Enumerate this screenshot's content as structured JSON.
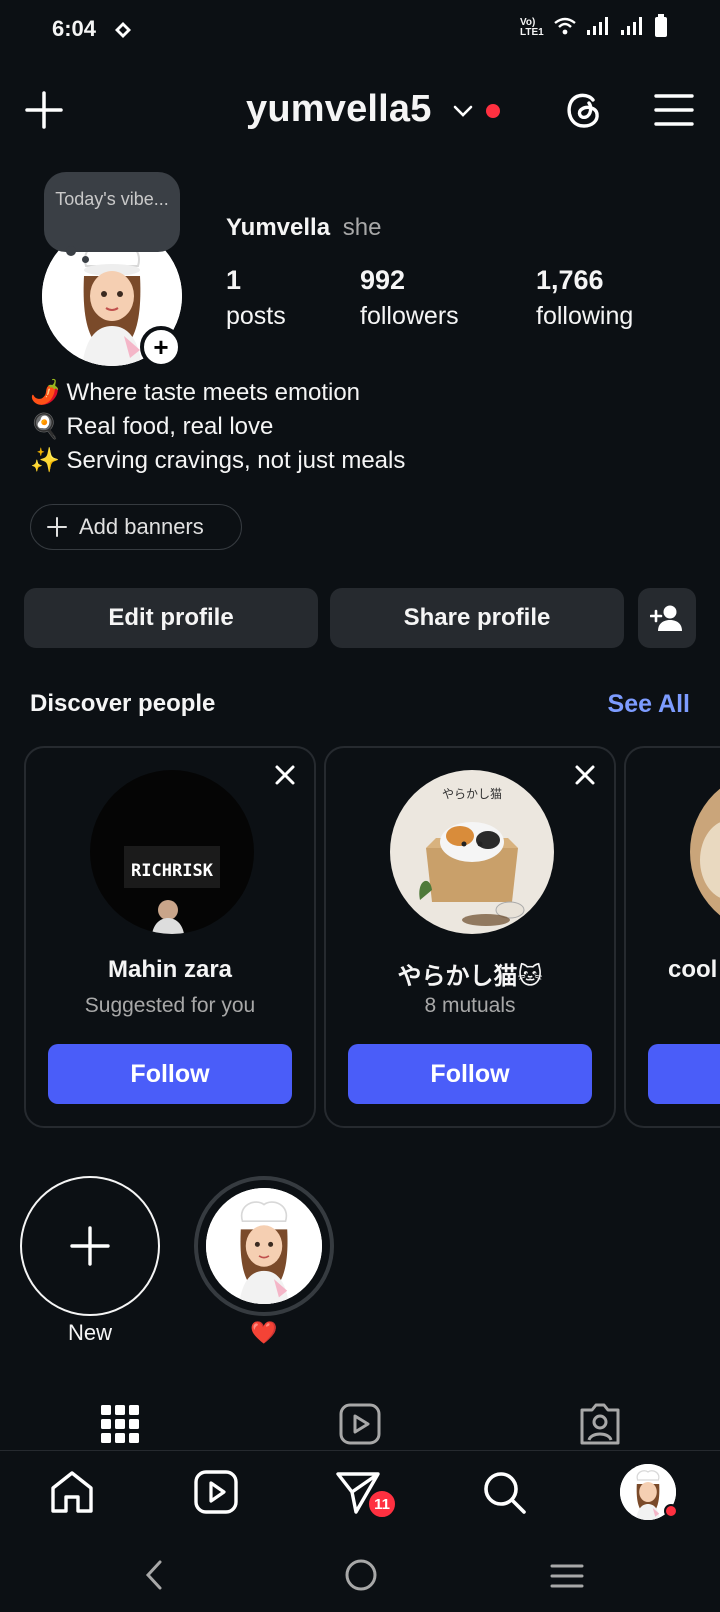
{
  "status_bar": {
    "time": "6:04",
    "network_label": "Vo) LTE1",
    "icons": [
      "gem-icon",
      "volte-icon",
      "wifi-icon",
      "signal-icon",
      "signal-icon",
      "battery-icon"
    ]
  },
  "header": {
    "username": "yumvella5",
    "has_notification_dot": true,
    "icons": [
      "plus-icon",
      "chevron-down-icon",
      "threads-icon",
      "menu-icon"
    ]
  },
  "profile": {
    "note": "Today's vibe...",
    "display_name": "Yumvella",
    "pronouns": "she",
    "stats": [
      {
        "value": "1",
        "label": "posts"
      },
      {
        "value": "992",
        "label": "followers"
      },
      {
        "value": "1,766",
        "label": "following"
      }
    ],
    "bio": [
      "🌶️ Where taste meets emotion",
      "🍳 Real food, real love",
      "✨ Serving cravings, not just meals"
    ],
    "add_banners_label": "Add banners",
    "edit_profile_label": "Edit profile",
    "share_profile_label": "Share profile"
  },
  "discover": {
    "title": "Discover people",
    "see_all": "See All",
    "cards": [
      {
        "name": "Mahin zara",
        "subtitle": "Suggested for you",
        "follow_label": "Follow",
        "pic_text": "RICHRISK"
      },
      {
        "name": "やらかし猫🐱",
        "subtitle": "8 mutuals",
        "follow_label": "Follow",
        "pic_text": "やらかし猫"
      },
      {
        "name": "cool",
        "subtitle": "",
        "follow_label": "",
        "pic_text": ""
      }
    ]
  },
  "highlights": [
    {
      "label": "New"
    },
    {
      "label": "❤️"
    }
  ],
  "tabs": [
    "grid-icon",
    "reels-icon",
    "tagged-icon"
  ],
  "bottom_nav": {
    "items": [
      "home-icon",
      "reels-icon",
      "messages-icon",
      "search-icon",
      "profile-avatar"
    ],
    "messages_badge": "11"
  },
  "colors": {
    "background": "#0c1014",
    "button": "#262a2f",
    "follow": "#4a5df9",
    "link": "#7d9cff",
    "notification": "#ff3040"
  }
}
